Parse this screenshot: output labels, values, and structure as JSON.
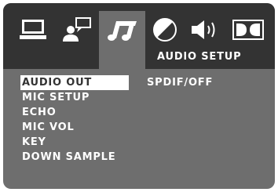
{
  "colors": {
    "screen_background": "#6e6e6e",
    "tab_bar_background": "#333333",
    "text": "#ffffff",
    "selection_background": "#ffffff",
    "selection_text": "#333333"
  },
  "tabs": [
    {
      "icon": "monitor-icon",
      "active": false
    },
    {
      "icon": "person-speech-icon",
      "active": false
    },
    {
      "icon": "music-note-icon",
      "active": true
    },
    {
      "icon": "half-circle-icon",
      "active": false
    },
    {
      "icon": "speaker-icon",
      "active": false
    },
    {
      "icon": "dolby-icon",
      "active": false
    }
  ],
  "header": {
    "title": "AUDIO SETUP"
  },
  "menu": {
    "items": [
      {
        "label": "AUDIO OUT",
        "selected": true
      },
      {
        "label": "MIC SETUP",
        "selected": false
      },
      {
        "label": "ECHO",
        "selected": false
      },
      {
        "label": "MIC VOL",
        "selected": false
      },
      {
        "label": "KEY",
        "selected": false
      },
      {
        "label": "DOWN SAMPLE",
        "selected": false
      }
    ]
  },
  "current_value": "SPDIF/OFF"
}
